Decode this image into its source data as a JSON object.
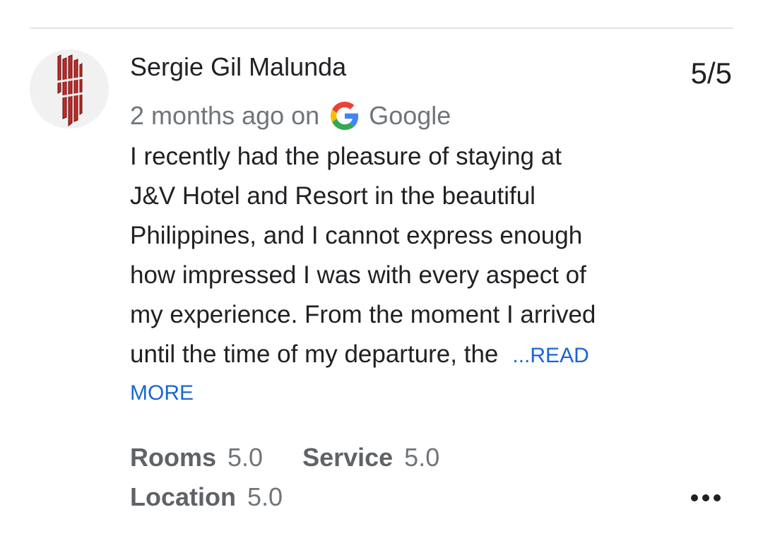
{
  "review": {
    "author": "Sergie Gil Malunda",
    "score": "5/5",
    "time_ago": "2 months ago on",
    "source": "Google",
    "text_lines": [
      "I recently had the pleasure of staying at",
      "J&V Hotel and Resort in the beautiful",
      "Philippines, and I cannot express enough",
      "how impressed I was with every aspect of",
      "my experience. From the moment I arrived",
      "until the time of my departure, the"
    ],
    "read_more_part1": "...READ",
    "read_more_part2": "MORE",
    "ratings": [
      {
        "label": "Rooms",
        "value": "5.0"
      },
      {
        "label": "Service",
        "value": "5.0"
      },
      {
        "label": "Location",
        "value": "5.0"
      }
    ]
  },
  "colors": {
    "link": "#1967d2",
    "avatar_mark": "#c62828",
    "muted_text": "#70757a"
  },
  "icons": {
    "avatar": "skrillex-logo-avatar",
    "source": "google-g-icon",
    "menu": "more-horizontal-icon"
  }
}
